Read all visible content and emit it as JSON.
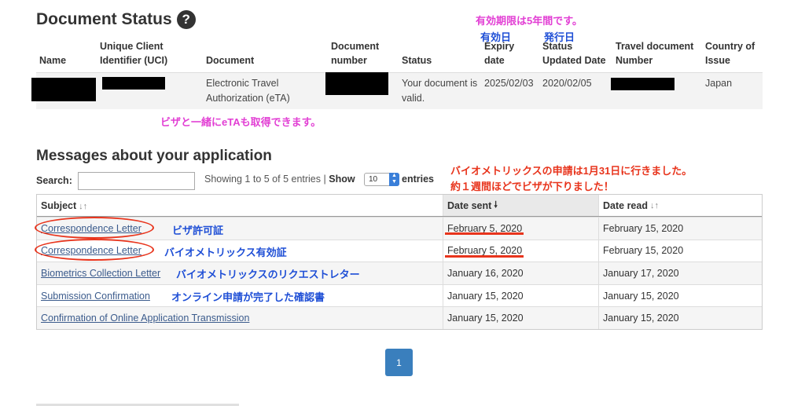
{
  "doc_status": {
    "title": "Document Status",
    "help_icon": "?",
    "headers": {
      "name": "Name",
      "uci": "Unique Client Identifier (UCI)",
      "document": "Document",
      "doc_number": "Document number",
      "status": "Status",
      "expiry": "Expiry date",
      "status_updated": "Status Updated Date",
      "travel_doc": "Travel document Number",
      "country": "Country of Issue"
    },
    "row": {
      "document": "Electronic Travel Authorization (eTA)",
      "status": "Your document is valid.",
      "expiry": "2025/02/03",
      "status_updated": "2020/02/05",
      "country": "Japan"
    }
  },
  "annotations": {
    "validity": "有効期限は5年間です。",
    "expiry_jp": "有効日",
    "issue_jp": "発行日",
    "with_visa": "ビザと一緒にeTAも取得できます。",
    "biometrics_note_1": "バイオメトリックスの申請は1月31日に行きました。",
    "biometrics_note_2": "約１週間ほどでビザが下りました！",
    "row1": "ビザ許可証",
    "row2": "バイオメトリックス有効証",
    "row3": "バイオメトリックスのリクエストレター",
    "row4": "オンライン申請が完了した確認書"
  },
  "messages": {
    "title": "Messages about your application",
    "search_label": "Search:",
    "showing": "Showing 1 to 5 of 5 entries",
    "separator": "|",
    "show_label": "Show",
    "page_length": "10",
    "entries_label": "entries",
    "columns": {
      "subject": "Subject",
      "date_sent": "Date sent",
      "date_read": "Date read"
    },
    "rows": [
      {
        "subject": "Correspondence Letter",
        "sent": "February 5, 2020",
        "read": "February 15, 2020"
      },
      {
        "subject": "Correspondence Letter",
        "sent": "February 5, 2020",
        "read": "February 15, 2020"
      },
      {
        "subject": "Biometrics Collection Letter",
        "sent": "January 16, 2020",
        "read": "January 17, 2020"
      },
      {
        "subject": "Submission Confirmation",
        "sent": "January 15, 2020",
        "read": "January 15, 2020"
      },
      {
        "subject": "Confirmation of Online Application Transmission",
        "sent": "January 15, 2020",
        "read": "January 15, 2020"
      }
    ],
    "page": "1"
  },
  "colors": {
    "annotation_pink": "#e23fd4",
    "annotation_blue": "#1f4fd6",
    "annotation_red": "#e8341c",
    "pagination_blue": "#3a7fbd"
  }
}
